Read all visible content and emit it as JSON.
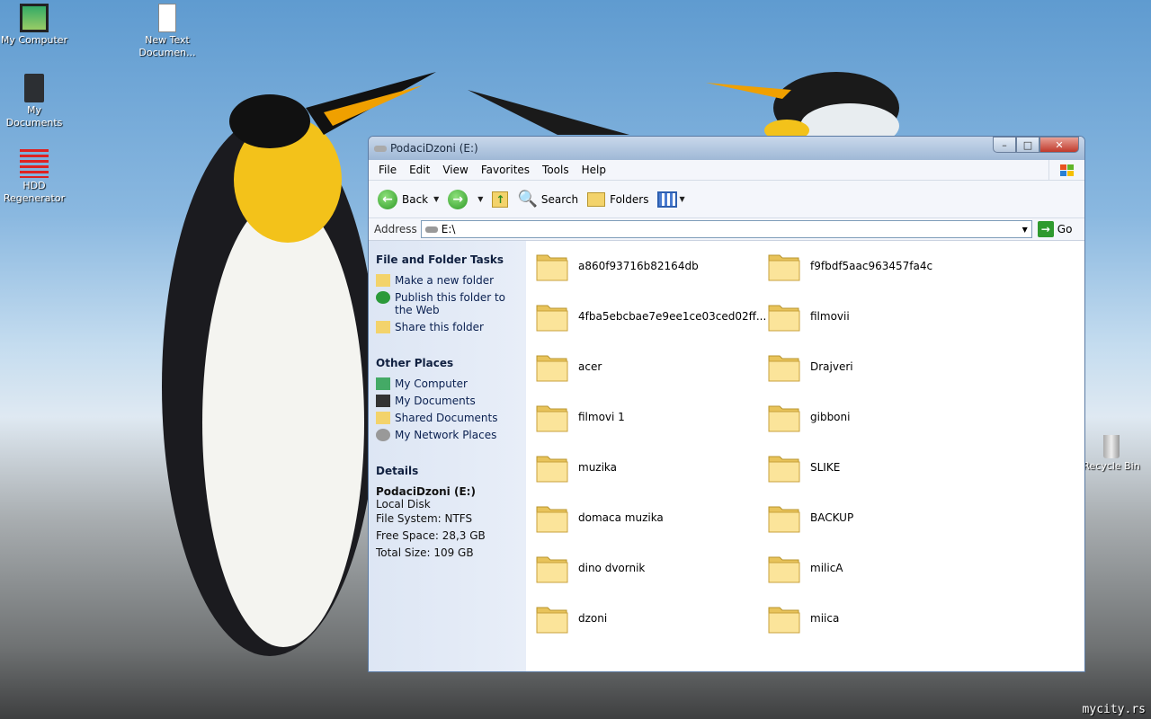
{
  "desktop": {
    "icons": [
      {
        "label": "My Computer",
        "icon": "computer-icon"
      },
      {
        "label": "My Documents",
        "icon": "documents-icon"
      },
      {
        "label": "HDD Regenerator",
        "icon": "hdd-regenerator-icon"
      },
      {
        "label": "New Text Documen...",
        "icon": "text-document-icon"
      },
      {
        "label": "Recycle Bin",
        "icon": "recycle-bin-icon"
      }
    ],
    "watermark": "mycity.rs"
  },
  "window": {
    "title": "PodaciDzoni (E:)",
    "menu": [
      "File",
      "Edit",
      "View",
      "Favorites",
      "Tools",
      "Help"
    ],
    "toolbar": {
      "back": "Back",
      "search": "Search",
      "folders": "Folders"
    },
    "address": {
      "label": "Address",
      "value": "E:\\",
      "go": "Go"
    },
    "tasks": {
      "title": "File and Folder Tasks",
      "items": [
        "Make a new folder",
        "Publish this folder to the Web",
        "Share this folder"
      ]
    },
    "places": {
      "title": "Other Places",
      "items": [
        "My Computer",
        "My Documents",
        "Shared Documents",
        "My Network Places"
      ]
    },
    "details": {
      "title": "Details",
      "name": "PodaciDzoni (E:)",
      "type": "Local Disk",
      "fs": "File System: NTFS",
      "free": "Free Space: 28,3 GB",
      "total": "Total Size: 109 GB"
    },
    "folders": [
      "a860f93716b82164db",
      "f9fbdf5aac963457fa4c",
      "4fba5ebcbae7e9ee1ce03ced02ff...",
      "filmovii",
      "acer",
      "Drajveri",
      "filmovi 1",
      "gibboni",
      "muzika",
      "SLIKE",
      "domaca muzika",
      "BACKUP",
      "dino dvornik",
      "milicA",
      "dzoni",
      "miica"
    ]
  }
}
